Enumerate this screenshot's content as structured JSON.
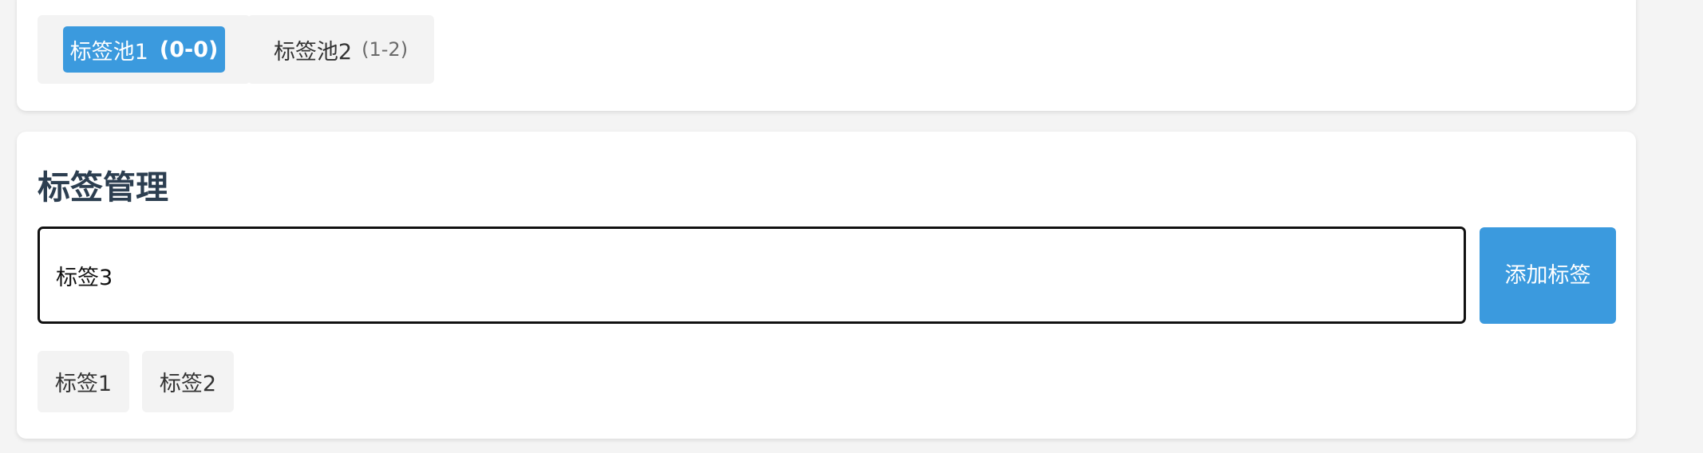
{
  "pools": {
    "items": [
      {
        "label": "标签池1",
        "range": "(0-0)",
        "active": true
      },
      {
        "label": "标签池2",
        "range": "(1-2)",
        "active": false
      }
    ]
  },
  "tag_management": {
    "title": "标签管理",
    "input_value": "标签3",
    "add_button_label": "添加标签",
    "tags": [
      {
        "label": "标签1"
      },
      {
        "label": "标签2"
      }
    ]
  },
  "colors": {
    "accent": "#3b9ade",
    "title": "#2c3e50",
    "chip_bg": "#f3f3f3",
    "page_bg": "#f4f4f4"
  }
}
